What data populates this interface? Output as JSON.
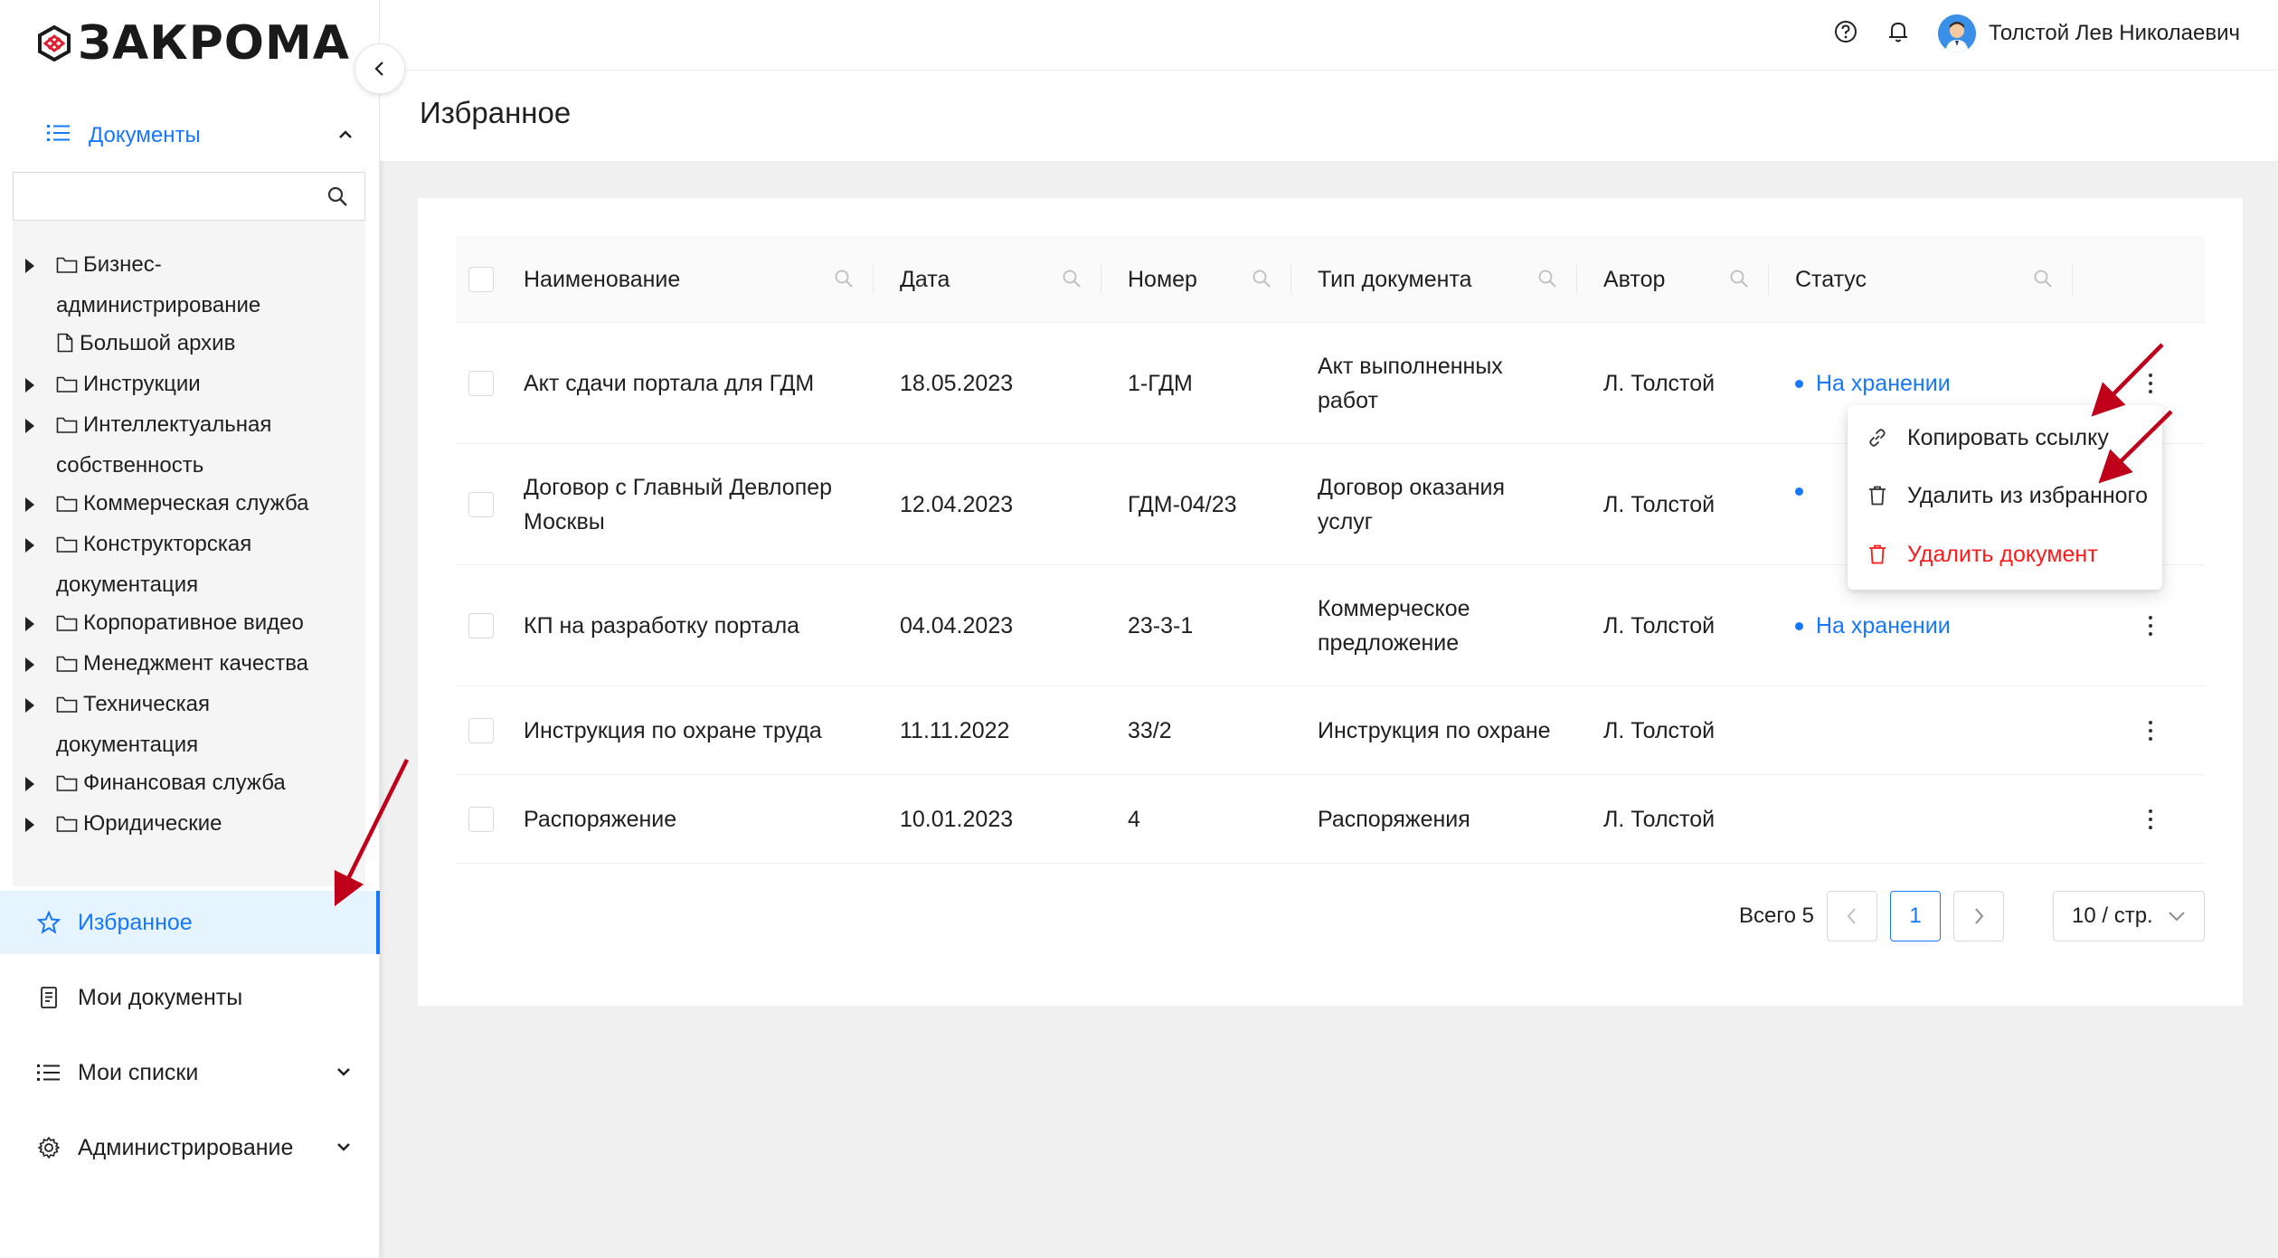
{
  "brand": {
    "logo_text": "ЗАКРОМА"
  },
  "user": {
    "name": "Толстой Лев Николаевич"
  },
  "page": {
    "title": "Избранное"
  },
  "sidebar": {
    "docs_label": "Документы",
    "tree": [
      {
        "label": "Бизнес-",
        "label2": "администрирование",
        "expandable": true,
        "icon": "folder-icon"
      },
      {
        "label": "Большой архив",
        "expandable": false,
        "icon": "file-icon"
      },
      {
        "label": "Инструкции",
        "expandable": true,
        "icon": "folder-icon"
      },
      {
        "label": "Интеллектуальная",
        "label2": "собственность",
        "expandable": true,
        "icon": "folder-icon"
      },
      {
        "label": "Коммерческая служба",
        "expandable": true,
        "icon": "folder-icon"
      },
      {
        "label": "Конструкторская",
        "label2": "документация",
        "expandable": true,
        "icon": "folder-icon"
      },
      {
        "label": "Корпоративное видео",
        "expandable": true,
        "icon": "folder-icon"
      },
      {
        "label": "Менеджмент качества",
        "expandable": true,
        "icon": "folder-icon"
      },
      {
        "label": "Техническая",
        "label2": "документация",
        "expandable": true,
        "icon": "folder-icon"
      },
      {
        "label": "Финансовая служба",
        "expandable": true,
        "icon": "folder-icon"
      },
      {
        "label": "Юридические",
        "expandable": true,
        "icon": "folder-icon"
      }
    ],
    "nav": [
      {
        "label": "Избранное",
        "icon": "star-icon",
        "active": true
      },
      {
        "label": "Мои документы",
        "icon": "document-icon"
      },
      {
        "label": "Мои списки",
        "icon": "list-icon"
      },
      {
        "label": "Администрирование",
        "icon": "gear-icon"
      }
    ]
  },
  "table": {
    "columns": [
      "Наименование",
      "Дата",
      "Номер",
      "Тип документа",
      "Автор",
      "Статус"
    ],
    "rows": [
      {
        "name": "Акт сдачи портала для ГДМ",
        "date": "18.05.2023",
        "number": "1-ГДМ",
        "type": "Акт выполненных",
        "type2": "работ",
        "author": "Л. Толстой",
        "status": "На хранении"
      },
      {
        "name": "Договор с Главный Девлопер",
        "name2": "Москвы",
        "date": "12.04.2023",
        "number": "ГДМ-04/23",
        "type": "Договор оказания",
        "type2": "услуг",
        "author": "Л. Толстой",
        "status": ""
      },
      {
        "name": "КП на разработку портала",
        "date": "04.04.2023",
        "number": "23-3-1",
        "type": "Коммерческое",
        "type2": "предложение",
        "author": "Л. Толстой",
        "status": "На хранении"
      },
      {
        "name": "Инструкция по охране труда",
        "date": "11.11.2022",
        "number": "33/2",
        "type": "Инструкция по охране",
        "author": "Л. Толстой",
        "status": ""
      },
      {
        "name": "Распоряжение",
        "date": "10.01.2023",
        "number": "4",
        "type": "Распоряжения",
        "author": "Л. Толстой",
        "status": ""
      }
    ]
  },
  "dropdown": {
    "items": [
      {
        "label": "Копировать ссылку",
        "icon": "link-icon"
      },
      {
        "label": "Удалить из избранного",
        "icon": "trash-icon"
      },
      {
        "label": "Удалить документ",
        "icon": "trash-icon",
        "danger": true
      }
    ]
  },
  "pagination": {
    "total": "Всего 5",
    "current": "1",
    "page_size": "10 / стр."
  },
  "colors": {
    "accent": "#1677ff",
    "danger": "#ff1a1a",
    "annotation_arrow": "#c0001a"
  }
}
